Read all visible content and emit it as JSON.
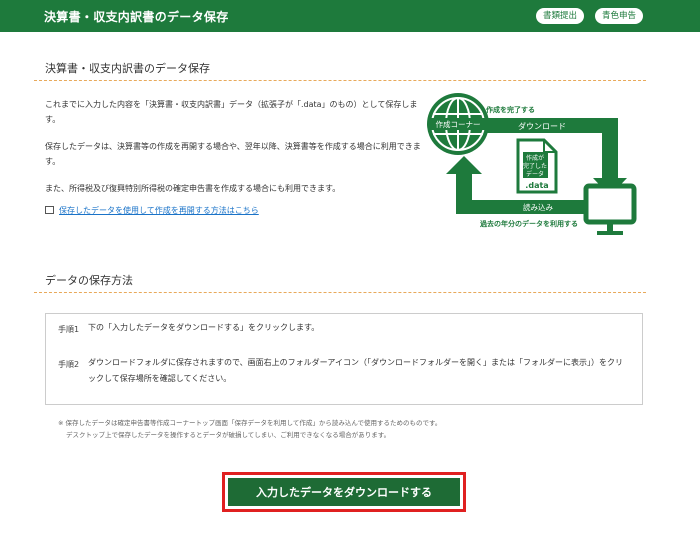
{
  "header": {
    "title": "決算書・収支内訳書のデータ保存",
    "buttons": [
      "書類提出",
      "青色申告"
    ]
  },
  "section1": {
    "title": "決算書・収支内訳書のデータ保存",
    "paragraphs": [
      "これまでに入力した内容を「決算書・収支内訳書」データ（拡張子が「.data」のもの）として保存します。",
      "保存したデータは、決算書等の作成を再開する場合や、翌年以降、決算書等を作成する場合に利用できます。",
      "また、所得税及び復興特別所得税の確定申告書を作成する場合にも利用できます。"
    ],
    "link": "保存したデータを使用して作成を再開する方法はこちら"
  },
  "diagram": {
    "globe_label": "作成コーナー",
    "top_caption": "作成を完了する",
    "top_arrow_label": "ダウンロード",
    "file_label_lines": [
      "作成が",
      "完了した",
      "データ"
    ],
    "file_ext": ".data",
    "bottom_arrow_label": "読み込み",
    "bottom_caption": "過去の年分のデータを利用する",
    "green": "#1e7a3c"
  },
  "section2": {
    "title": "データの保存方法",
    "steps": [
      {
        "num": "手順1",
        "text": "下の「入力したデータをダウンロードする」をクリックします。"
      },
      {
        "num": "手順2",
        "text": "ダウンロードフォルダに保存されますので、画面右上のフォルダーアイコン（「ダウンロードフォルダーを開く」または「フォルダーに表示」）をクリックして保存場所を確認してください。"
      }
    ],
    "notes": [
      "※ 保存したデータは確定申告書等作成コーナートップ画面「保存データを利用して作成」から読み込んで使用するためのものです。",
      "デスクトップ上で保存したデータを操作するとデータが破損してしまい、ご利用できなくなる場合があります。"
    ]
  },
  "download_button": "入力したデータをダウンロードする"
}
